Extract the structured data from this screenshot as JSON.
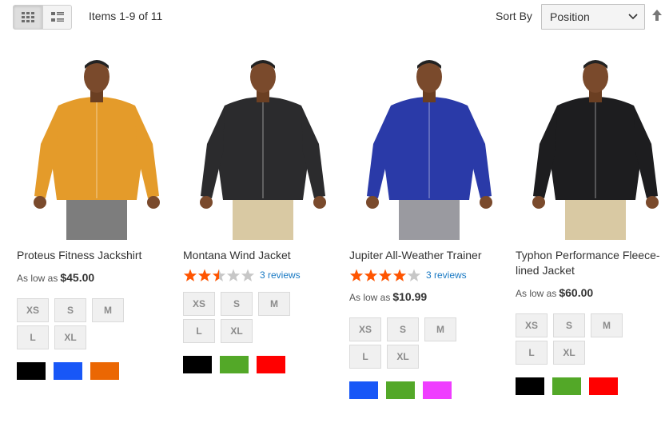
{
  "toolbar": {
    "amount_text": "Items 1-9 of 11",
    "sort_label": "Sort By",
    "sort_value": "Position",
    "grid_mode_icon": "grid-icon",
    "list_mode_icon": "list-icon",
    "sort_direction_icon": "arrow-up-icon"
  },
  "products": [
    {
      "name": "Proteus Fitness Jackshirt",
      "price_prefix": "As low as",
      "price": "$45.00",
      "rating": null,
      "reviews": null,
      "sizes": [
        "XS",
        "S",
        "M",
        "L",
        "XL"
      ],
      "colors": [
        "#000000",
        "#1857f7",
        "#eb6703"
      ],
      "jacket_color": "#e49b2a"
    },
    {
      "name": "Montana Wind Jacket",
      "price_prefix": "",
      "price": "",
      "rating": 2.5,
      "reviews": "3 reviews",
      "sizes": [
        "XS",
        "S",
        "M",
        "L",
        "XL"
      ],
      "colors": [
        "#000000",
        "#53a828",
        "#ff0000"
      ],
      "jacket_color": "#2b2b2d"
    },
    {
      "name": "Jupiter All-Weather Trainer",
      "price_prefix": "As low as",
      "price": "$10.99",
      "rating": 4,
      "reviews": "3 reviews",
      "sizes": [
        "XS",
        "S",
        "M",
        "L",
        "XL"
      ],
      "colors": [
        "#1857f7",
        "#53a828",
        "#ef3dff"
      ],
      "jacket_color": "#2a3aa8"
    },
    {
      "name": "Typhon Performance Fleece-lined Jacket",
      "price_prefix": "As low as",
      "price": "$60.00",
      "rating": null,
      "reviews": null,
      "sizes": [
        "XS",
        "S",
        "M",
        "L",
        "XL"
      ],
      "colors": [
        "#000000",
        "#53a828",
        "#ff0000"
      ],
      "jacket_color": "#1d1d1f"
    }
  ],
  "colors": {
    "star_filled": "#ff5501",
    "star_empty": "#c7c7c7",
    "link": "#1979c3"
  }
}
